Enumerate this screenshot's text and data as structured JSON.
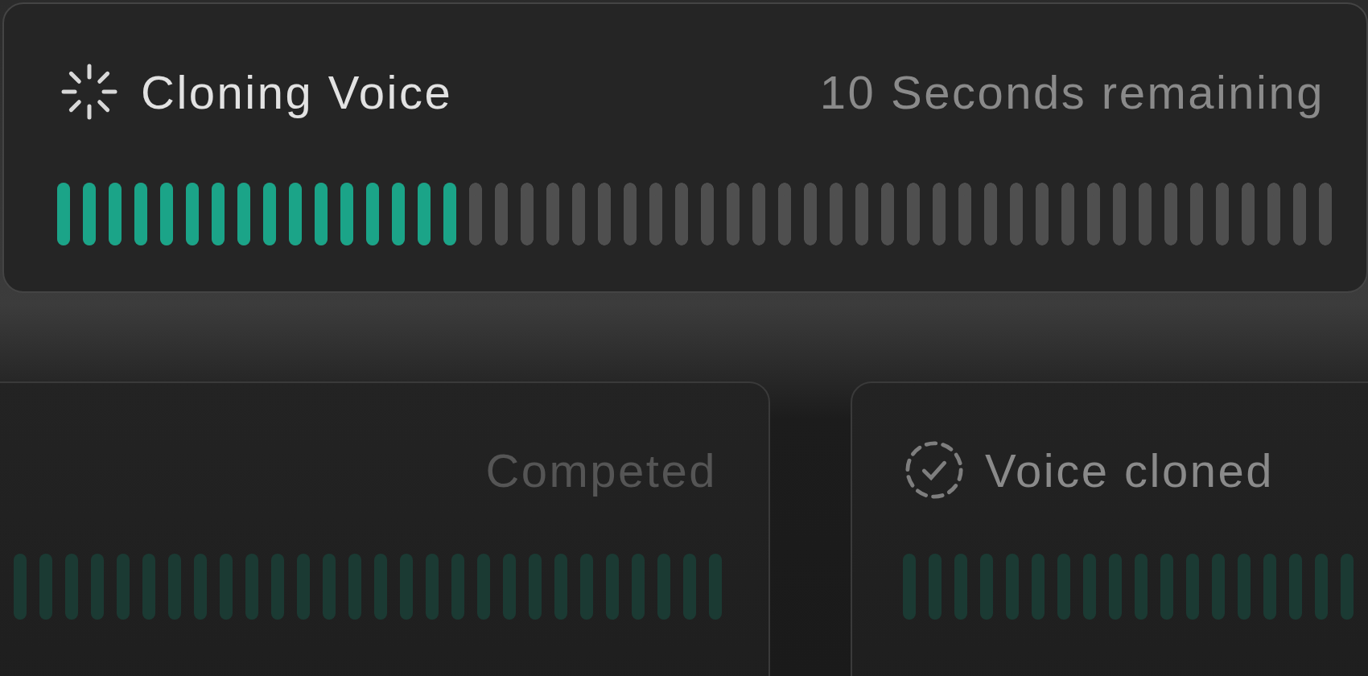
{
  "cards": [
    {
      "kind": "loading",
      "title": "Cloning Voice",
      "status": "10 Seconds remaining",
      "level": 0.32
    },
    {
      "kind": "completed",
      "status": "Competed"
    },
    {
      "kind": "cloned",
      "title": "Voice cloned"
    }
  ]
}
